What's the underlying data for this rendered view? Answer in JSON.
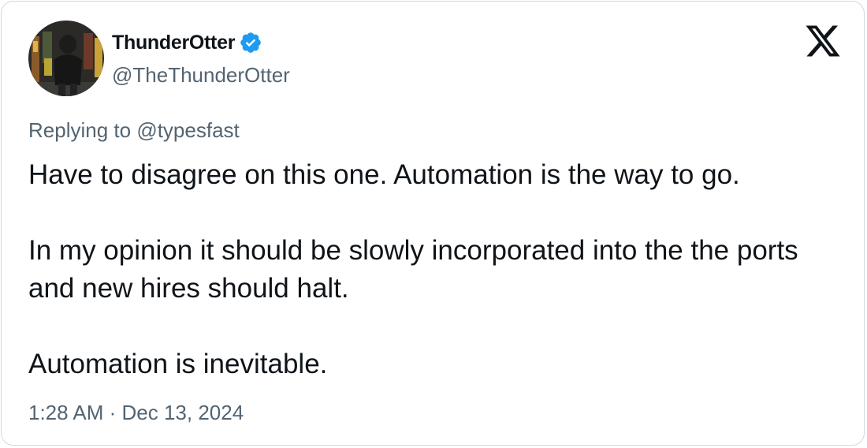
{
  "author": {
    "display_name": "ThunderOtter",
    "handle": "@TheThunderOtter",
    "verified": true,
    "verified_color": "#1d9bf0"
  },
  "platform_icon": "x-logo-icon",
  "reply": {
    "prefix": "Replying to",
    "mention": "@typesfast"
  },
  "tweet": {
    "paragraphs": [
      "Have to disagree on this one. Automation is the way to go.",
      "In my opinion it should be slowly incorporated into the the ports and new hires should halt.",
      "Automation is inevitable."
    ]
  },
  "meta": {
    "timestamp": "1:28 AM · Dec 13, 2024"
  },
  "colors": {
    "text_primary": "#0f1419",
    "text_secondary": "#536471",
    "border": "#cfd9de"
  }
}
